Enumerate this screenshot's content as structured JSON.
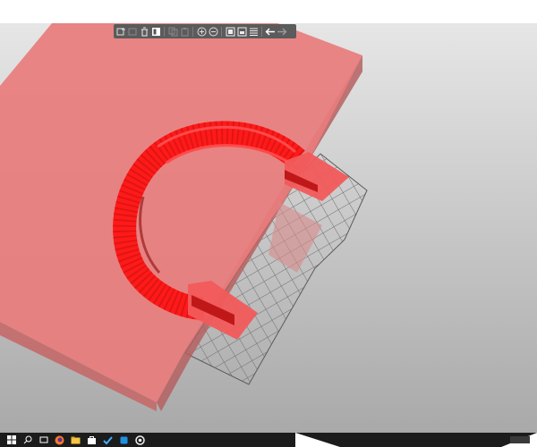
{
  "window": {
    "background": "#ffffff"
  },
  "viewport": {
    "background_gradient": [
      "#e6e6e6",
      "#a9a9a9"
    ],
    "model_color": "#e87c7c",
    "part_color": "#ff1a1a",
    "bed_grid_color": "#6e6e6e"
  },
  "toolbar": {
    "buttons": [
      {
        "id": "add",
        "icon": "add-object-icon",
        "enabled": true
      },
      {
        "id": "delete",
        "icon": "delete-icon",
        "enabled": false
      },
      {
        "id": "delete-all",
        "icon": "trash-icon",
        "enabled": true
      },
      {
        "id": "arrange",
        "icon": "arrange-icon",
        "enabled": true
      },
      {
        "id": "copy",
        "icon": "copy-icon",
        "enabled": false
      },
      {
        "id": "paste",
        "icon": "paste-icon",
        "enabled": false
      },
      {
        "id": "add-instance",
        "icon": "plus-circle-icon",
        "enabled": true
      },
      {
        "id": "remove-instance",
        "icon": "minus-circle-icon",
        "enabled": true
      },
      {
        "id": "split-objects",
        "icon": "split-objects-icon",
        "enabled": true
      },
      {
        "id": "split-parts",
        "icon": "split-parts-icon",
        "enabled": true
      },
      {
        "id": "layers",
        "icon": "layers-editing-icon",
        "enabled": true
      },
      {
        "id": "undo",
        "icon": "undo-arrow-icon",
        "enabled": true
      },
      {
        "id": "redo",
        "icon": "redo-arrow-icon",
        "enabled": false
      }
    ]
  },
  "taskbar": {
    "background": "#1c1c1c",
    "icons": [
      {
        "id": "start",
        "icon": "windows-start-icon"
      },
      {
        "id": "search",
        "icon": "search-icon"
      },
      {
        "id": "task-view",
        "icon": "task-view-icon"
      },
      {
        "id": "firefox",
        "icon": "firefox-icon"
      },
      {
        "id": "explorer",
        "icon": "file-explorer-icon"
      },
      {
        "id": "store",
        "icon": "store-icon"
      },
      {
        "id": "app-check",
        "icon": "check-app-icon"
      },
      {
        "id": "app-blue",
        "icon": "app-icon"
      },
      {
        "id": "app-circle",
        "icon": "circle-app-icon"
      }
    ]
  }
}
